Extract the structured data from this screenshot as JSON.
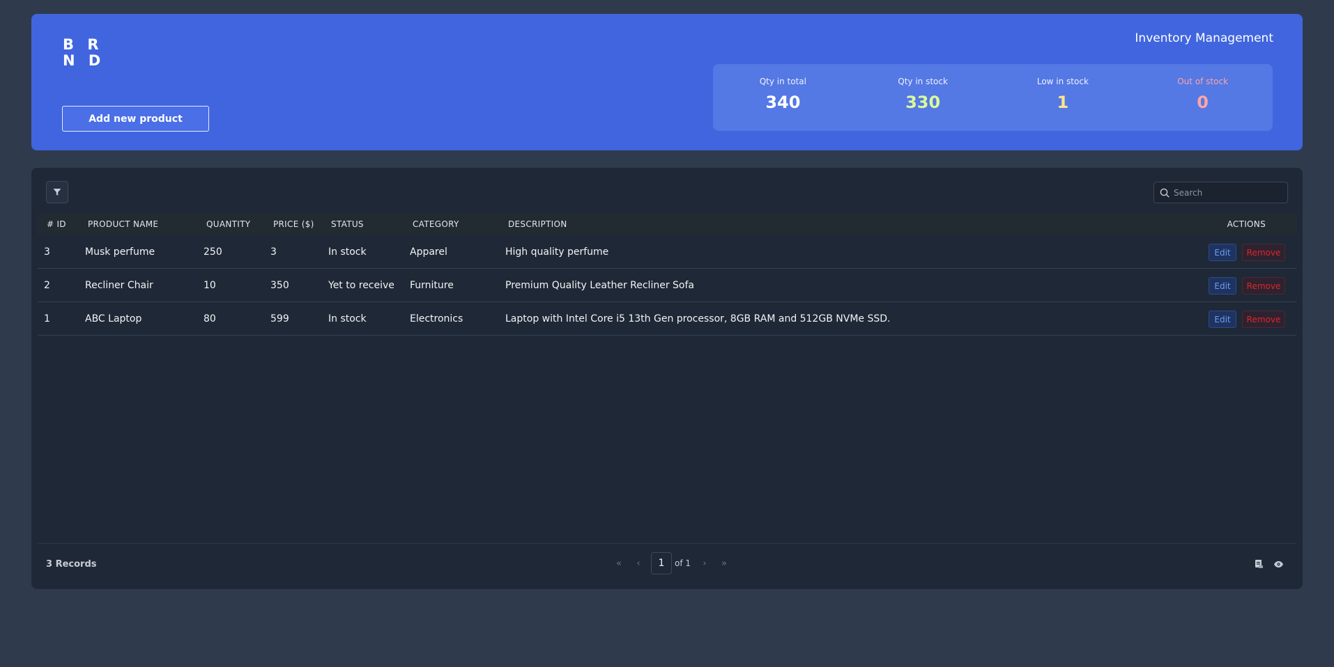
{
  "brand": {
    "line1": "B R",
    "line2": "N D"
  },
  "header": {
    "title": "Inventory Management",
    "add_button_label": "Add new product"
  },
  "stats": {
    "total": {
      "label": "Qty in total",
      "value": "340"
    },
    "in_stock": {
      "label": "Qty in stock",
      "value": "330"
    },
    "low_stock": {
      "label": "Low in stock",
      "value": "1"
    },
    "out_of_stock": {
      "label": "Out of stock",
      "value": "0"
    }
  },
  "toolbar": {
    "filter_icon": "filter-icon",
    "search_icon": "search-icon",
    "search_placeholder": "Search"
  },
  "table": {
    "columns": {
      "id": "# ID",
      "name": "PRODUCT NAME",
      "quantity": "QUANTITY",
      "price": "PRICE ($)",
      "status": "STATUS",
      "category": "CATEGORY",
      "description": "DESCRIPTION",
      "actions": "ACTIONS"
    },
    "rows": [
      {
        "id": "3",
        "name": "Musk perfume",
        "quantity": "250",
        "price": "3",
        "status": "In stock",
        "category": "Apparel",
        "description": "High quality perfume"
      },
      {
        "id": "2",
        "name": "Recliner Chair",
        "quantity": "10",
        "price": "350",
        "status": "Yet to receive",
        "category": "Furniture",
        "description": "Premium Quality Leather Recliner Sofa"
      },
      {
        "id": "1",
        "name": "ABC Laptop",
        "quantity": "80",
        "price": "599",
        "status": "In stock",
        "category": "Electronics",
        "description": "Laptop with Intel Core i5 13th Gen processor, 8GB RAM and 512GB NVMe SSD."
      }
    ],
    "edit_label": "Edit",
    "remove_label": "Remove"
  },
  "footer": {
    "records": "3 Records",
    "pager": {
      "first": "«",
      "prev": "‹",
      "current": "1",
      "of": "of 1",
      "next": "›",
      "last": "»"
    },
    "icons": [
      "export-icon",
      "view-icon"
    ]
  },
  "colors": {
    "header_bg": "#4065df",
    "stats_bg": "#5478e4",
    "panel_bg": "#1f2836",
    "page_bg": "#2f3b4c",
    "in_stock_value": "#d9f99d",
    "low_stock_value": "#fde68a",
    "out_of_stock": "#fca5a5",
    "edit": "#6b9cf5",
    "remove": "#dc2626"
  }
}
